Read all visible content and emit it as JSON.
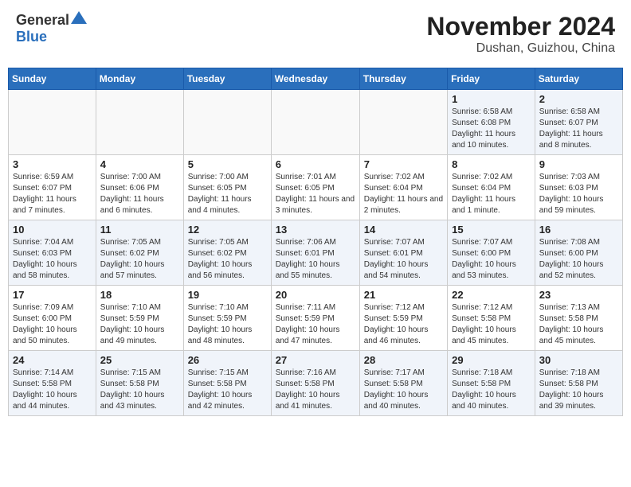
{
  "logo": {
    "general": "General",
    "blue": "Blue"
  },
  "title": "November 2024",
  "subtitle": "Dushan, Guizhou, China",
  "days_of_week": [
    "Sunday",
    "Monday",
    "Tuesday",
    "Wednesday",
    "Thursday",
    "Friday",
    "Saturday"
  ],
  "weeks": [
    [
      {
        "day": "",
        "info": ""
      },
      {
        "day": "",
        "info": ""
      },
      {
        "day": "",
        "info": ""
      },
      {
        "day": "",
        "info": ""
      },
      {
        "day": "",
        "info": ""
      },
      {
        "day": "1",
        "info": "Sunrise: 6:58 AM\nSunset: 6:08 PM\nDaylight: 11 hours and 10 minutes."
      },
      {
        "day": "2",
        "info": "Sunrise: 6:58 AM\nSunset: 6:07 PM\nDaylight: 11 hours and 8 minutes."
      }
    ],
    [
      {
        "day": "3",
        "info": "Sunrise: 6:59 AM\nSunset: 6:07 PM\nDaylight: 11 hours and 7 minutes."
      },
      {
        "day": "4",
        "info": "Sunrise: 7:00 AM\nSunset: 6:06 PM\nDaylight: 11 hours and 6 minutes."
      },
      {
        "day": "5",
        "info": "Sunrise: 7:00 AM\nSunset: 6:05 PM\nDaylight: 11 hours and 4 minutes."
      },
      {
        "day": "6",
        "info": "Sunrise: 7:01 AM\nSunset: 6:05 PM\nDaylight: 11 hours and 3 minutes."
      },
      {
        "day": "7",
        "info": "Sunrise: 7:02 AM\nSunset: 6:04 PM\nDaylight: 11 hours and 2 minutes."
      },
      {
        "day": "8",
        "info": "Sunrise: 7:02 AM\nSunset: 6:04 PM\nDaylight: 11 hours and 1 minute."
      },
      {
        "day": "9",
        "info": "Sunrise: 7:03 AM\nSunset: 6:03 PM\nDaylight: 10 hours and 59 minutes."
      }
    ],
    [
      {
        "day": "10",
        "info": "Sunrise: 7:04 AM\nSunset: 6:03 PM\nDaylight: 10 hours and 58 minutes."
      },
      {
        "day": "11",
        "info": "Sunrise: 7:05 AM\nSunset: 6:02 PM\nDaylight: 10 hours and 57 minutes."
      },
      {
        "day": "12",
        "info": "Sunrise: 7:05 AM\nSunset: 6:02 PM\nDaylight: 10 hours and 56 minutes."
      },
      {
        "day": "13",
        "info": "Sunrise: 7:06 AM\nSunset: 6:01 PM\nDaylight: 10 hours and 55 minutes."
      },
      {
        "day": "14",
        "info": "Sunrise: 7:07 AM\nSunset: 6:01 PM\nDaylight: 10 hours and 54 minutes."
      },
      {
        "day": "15",
        "info": "Sunrise: 7:07 AM\nSunset: 6:00 PM\nDaylight: 10 hours and 53 minutes."
      },
      {
        "day": "16",
        "info": "Sunrise: 7:08 AM\nSunset: 6:00 PM\nDaylight: 10 hours and 52 minutes."
      }
    ],
    [
      {
        "day": "17",
        "info": "Sunrise: 7:09 AM\nSunset: 6:00 PM\nDaylight: 10 hours and 50 minutes."
      },
      {
        "day": "18",
        "info": "Sunrise: 7:10 AM\nSunset: 5:59 PM\nDaylight: 10 hours and 49 minutes."
      },
      {
        "day": "19",
        "info": "Sunrise: 7:10 AM\nSunset: 5:59 PM\nDaylight: 10 hours and 48 minutes."
      },
      {
        "day": "20",
        "info": "Sunrise: 7:11 AM\nSunset: 5:59 PM\nDaylight: 10 hours and 47 minutes."
      },
      {
        "day": "21",
        "info": "Sunrise: 7:12 AM\nSunset: 5:59 PM\nDaylight: 10 hours and 46 minutes."
      },
      {
        "day": "22",
        "info": "Sunrise: 7:12 AM\nSunset: 5:58 PM\nDaylight: 10 hours and 45 minutes."
      },
      {
        "day": "23",
        "info": "Sunrise: 7:13 AM\nSunset: 5:58 PM\nDaylight: 10 hours and 45 minutes."
      }
    ],
    [
      {
        "day": "24",
        "info": "Sunrise: 7:14 AM\nSunset: 5:58 PM\nDaylight: 10 hours and 44 minutes."
      },
      {
        "day": "25",
        "info": "Sunrise: 7:15 AM\nSunset: 5:58 PM\nDaylight: 10 hours and 43 minutes."
      },
      {
        "day": "26",
        "info": "Sunrise: 7:15 AM\nSunset: 5:58 PM\nDaylight: 10 hours and 42 minutes."
      },
      {
        "day": "27",
        "info": "Sunrise: 7:16 AM\nSunset: 5:58 PM\nDaylight: 10 hours and 41 minutes."
      },
      {
        "day": "28",
        "info": "Sunrise: 7:17 AM\nSunset: 5:58 PM\nDaylight: 10 hours and 40 minutes."
      },
      {
        "day": "29",
        "info": "Sunrise: 7:18 AM\nSunset: 5:58 PM\nDaylight: 10 hours and 40 minutes."
      },
      {
        "day": "30",
        "info": "Sunrise: 7:18 AM\nSunset: 5:58 PM\nDaylight: 10 hours and 39 minutes."
      }
    ]
  ]
}
